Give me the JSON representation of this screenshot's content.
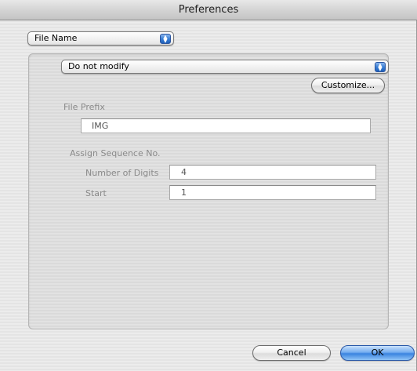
{
  "window": {
    "title": "Preferences"
  },
  "category_popup": {
    "value": "File Name"
  },
  "mode_popup": {
    "value": "Do not modify"
  },
  "customize_button": {
    "label": "Customize..."
  },
  "file_prefix": {
    "label": "File Prefix",
    "value": "IMG"
  },
  "sequence": {
    "label": "Assign Sequence No.",
    "digits_label": "Number of Digits",
    "digits_value": "4",
    "start_label": "Start",
    "start_value": "1"
  },
  "footer": {
    "cancel_label": "Cancel",
    "ok_label": "OK"
  },
  "icons": {
    "popup_arrows": "up-down-arrows-icon"
  },
  "colors": {
    "accent": "#3a83e0"
  }
}
